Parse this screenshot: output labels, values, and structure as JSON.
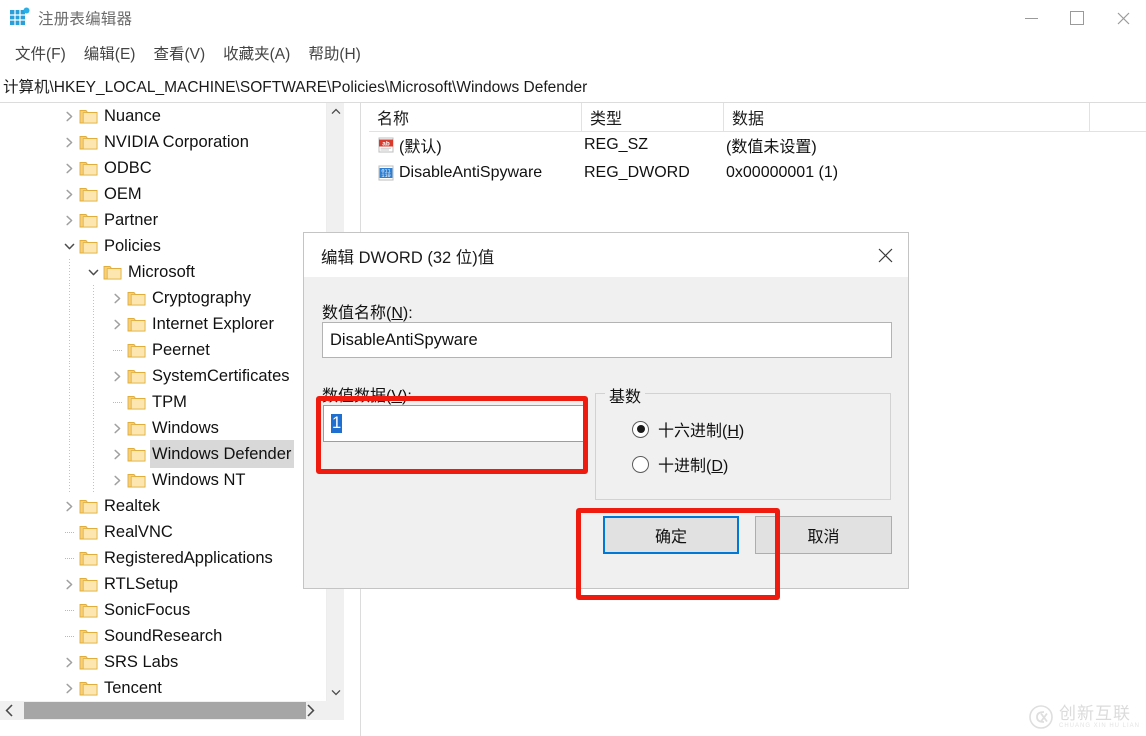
{
  "window": {
    "title": "注册表编辑器",
    "icon": "registry-editor-icon",
    "controls": {
      "minimize": "minimize-icon",
      "maximize": "maximize-icon",
      "close": "close-icon"
    }
  },
  "menubar": {
    "items": [
      {
        "label": "文件(F)",
        "name": "menu-file"
      },
      {
        "label": "编辑(E)",
        "name": "menu-edit"
      },
      {
        "label": "查看(V)",
        "name": "menu-view"
      },
      {
        "label": "收藏夹(A)",
        "name": "menu-favorites"
      },
      {
        "label": "帮助(H)",
        "name": "menu-help"
      }
    ]
  },
  "address": {
    "path": "计算机\\HKEY_LOCAL_MACHINE\\SOFTWARE\\Policies\\Microsoft\\Windows Defender"
  },
  "tree": {
    "items": [
      {
        "label": "Nuance",
        "indent": 1,
        "expander": "collapsed",
        "selected": false
      },
      {
        "label": "NVIDIA Corporation",
        "indent": 1,
        "expander": "collapsed",
        "selected": false
      },
      {
        "label": "ODBC",
        "indent": 1,
        "expander": "collapsed",
        "selected": false
      },
      {
        "label": "OEM",
        "indent": 1,
        "expander": "collapsed",
        "selected": false
      },
      {
        "label": "Partner",
        "indent": 1,
        "expander": "collapsed",
        "selected": false
      },
      {
        "label": "Policies",
        "indent": 1,
        "expander": "expanded",
        "selected": false
      },
      {
        "label": "Microsoft",
        "indent": 2,
        "expander": "expanded",
        "selected": false
      },
      {
        "label": "Cryptography",
        "indent": 3,
        "expander": "collapsed",
        "selected": false
      },
      {
        "label": "Internet Explorer",
        "indent": 3,
        "expander": "collapsed",
        "selected": false
      },
      {
        "label": "Peernet",
        "indent": 3,
        "expander": "leaf",
        "selected": false
      },
      {
        "label": "SystemCertificates",
        "indent": 3,
        "expander": "collapsed",
        "selected": false
      },
      {
        "label": "TPM",
        "indent": 3,
        "expander": "leaf",
        "selected": false
      },
      {
        "label": "Windows",
        "indent": 3,
        "expander": "collapsed",
        "selected": false
      },
      {
        "label": "Windows Defender",
        "indent": 3,
        "expander": "collapsed",
        "selected": true
      },
      {
        "label": "Windows NT",
        "indent": 3,
        "expander": "collapsed",
        "selected": false
      },
      {
        "label": "Realtek",
        "indent": 1,
        "expander": "collapsed",
        "selected": false
      },
      {
        "label": "RealVNC",
        "indent": 1,
        "expander": "leaf",
        "selected": false
      },
      {
        "label": "RegisteredApplications",
        "indent": 1,
        "expander": "leaf",
        "selected": false
      },
      {
        "label": "RTLSetup",
        "indent": 1,
        "expander": "collapsed",
        "selected": false
      },
      {
        "label": "SonicFocus",
        "indent": 1,
        "expander": "leaf",
        "selected": false
      },
      {
        "label": "SoundResearch",
        "indent": 1,
        "expander": "leaf",
        "selected": false
      },
      {
        "label": "SRS Labs",
        "indent": 1,
        "expander": "collapsed",
        "selected": false
      },
      {
        "label": "Tencent",
        "indent": 1,
        "expander": "collapsed",
        "selected": false
      }
    ],
    "scroll": {
      "up_arrow": "chevron-up-icon",
      "down_arrow": "chevron-down-icon",
      "left_arrow": "chevron-left-icon",
      "right_arrow": "chevron-right-icon"
    }
  },
  "list": {
    "columns": [
      {
        "label": "名称",
        "name": "column-name"
      },
      {
        "label": "类型",
        "name": "column-type"
      },
      {
        "label": "数据",
        "name": "column-data"
      }
    ],
    "rows": [
      {
        "icon": "string-value-icon",
        "name": "(默认)",
        "type": "REG_SZ",
        "data": "(数值未设置)"
      },
      {
        "icon": "dword-value-icon",
        "name": "DisableAntiSpyware",
        "type": "REG_DWORD",
        "data": "0x00000001 (1)"
      }
    ]
  },
  "dialog": {
    "title": "编辑 DWORD (32 位)值",
    "close_icon": "close-icon",
    "value_name_label": "数值名称(N):",
    "value_name": "DisableAntiSpyware",
    "value_data_label": "数值数据(V):",
    "value_data": "1",
    "radix": {
      "title": "基数",
      "options": [
        {
          "label": "十六进制(H)",
          "selected": true,
          "name": "radio-hexadecimal"
        },
        {
          "label": "十进制(D)",
          "selected": false,
          "name": "radio-decimal"
        }
      ]
    },
    "ok_label": "确定",
    "cancel_label": "取消"
  },
  "annotations": {
    "highlight_color": "#f01b0f",
    "boxes": [
      {
        "name": "highlight-value-data-field"
      },
      {
        "name": "highlight-ok-button"
      }
    ]
  },
  "watermark": {
    "text": "创新互联",
    "sub": "CHUANG XIN HU LIAN"
  }
}
